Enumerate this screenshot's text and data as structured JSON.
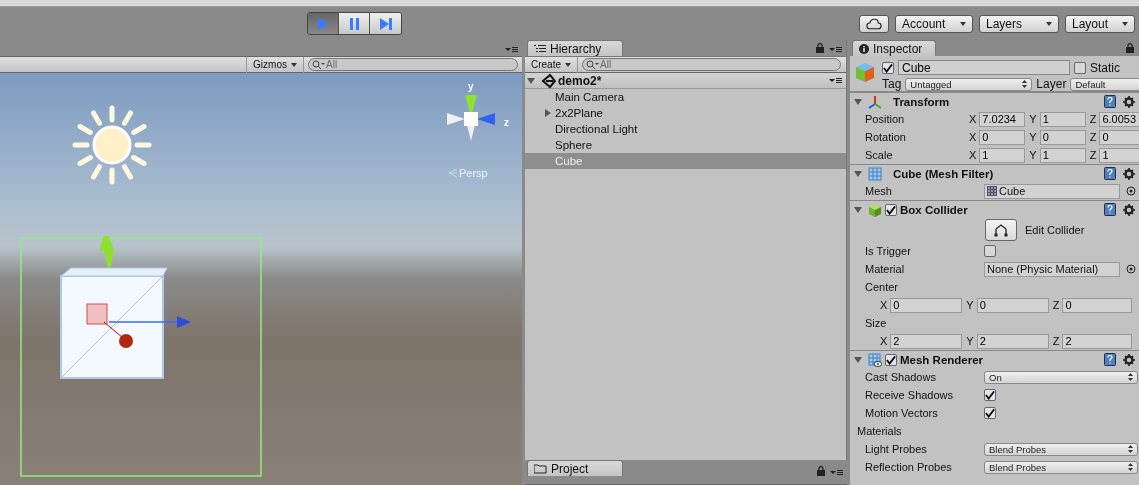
{
  "toolbar": {
    "play_controls": [
      {
        "kind": "play",
        "selected": true
      },
      {
        "kind": "pause",
        "selected": false
      },
      {
        "kind": "step",
        "selected": false
      }
    ],
    "account": "Account",
    "layers": "Layers",
    "layout": "Layout"
  },
  "scene": {
    "gizmos": "Gizmos",
    "search_placeholder": "All",
    "axis_y": "y",
    "axis_z": "z",
    "projection": "Persp"
  },
  "hierarchy": {
    "tab": "Hierarchy",
    "create": "Create",
    "search_placeholder": "All",
    "scene": "demo2*",
    "expanded": true,
    "items": [
      {
        "label": "Main Camera",
        "selected": false,
        "has_children": false
      },
      {
        "label": "2x2Plane",
        "selected": false,
        "has_children": true
      },
      {
        "label": "Directional Light",
        "selected": false,
        "has_children": false
      },
      {
        "label": "Sphere",
        "selected": false,
        "has_children": false
      },
      {
        "label": "Cube",
        "selected": true,
        "has_children": false
      }
    ]
  },
  "project": {
    "tab": "Project"
  },
  "inspector": {
    "tab": "Inspector",
    "active": true,
    "name": "Cube",
    "static_label": "Static",
    "static": false,
    "tag_label": "Tag",
    "tag": "Untagged",
    "layer_label": "Layer",
    "layer": "Default",
    "components": [
      {
        "kind": "transform",
        "title": "Transform",
        "expanded": true,
        "rows": [
          {
            "kind": "vector",
            "label": "Position",
            "fields": [
              {
                "axis": "X",
                "value": "7.0234"
              },
              {
                "axis": "Y",
                "value": "1"
              },
              {
                "axis": "Z",
                "value": "6.0053"
              }
            ]
          },
          {
            "kind": "vector",
            "label": "Rotation",
            "fields": [
              {
                "axis": "X",
                "value": "0"
              },
              {
                "axis": "Y",
                "value": "0"
              },
              {
                "axis": "Z",
                "value": "0"
              }
            ]
          },
          {
            "kind": "vector",
            "label": "Scale",
            "fields": [
              {
                "axis": "X",
                "value": "1"
              },
              {
                "axis": "Y",
                "value": "1"
              },
              {
                "axis": "Z",
                "value": "1"
              }
            ]
          }
        ]
      },
      {
        "kind": "mesh_filter",
        "title": "Cube (Mesh Filter)",
        "expanded": true,
        "rows": [
          {
            "kind": "object",
            "label": "Mesh",
            "value": "Cube"
          }
        ]
      },
      {
        "kind": "box_collider",
        "title": "Box Collider",
        "enabled": true,
        "expanded": true,
        "rows": [
          {
            "kind": "button",
            "label": "Edit Collider"
          },
          {
            "kind": "checkbox",
            "label": "Is Trigger",
            "checked": false
          },
          {
            "kind": "object",
            "label": "Material",
            "value": "None (Physic Material)"
          },
          {
            "kind": "heading",
            "label": "Center"
          },
          {
            "kind": "subvector",
            "fields": [
              {
                "axis": "X",
                "value": "0"
              },
              {
                "axis": "Y",
                "value": "0"
              },
              {
                "axis": "Z",
                "value": "0"
              }
            ]
          },
          {
            "kind": "heading",
            "label": "Size"
          },
          {
            "kind": "subvector",
            "fields": [
              {
                "axis": "X",
                "value": "2"
              },
              {
                "axis": "Y",
                "value": "2"
              },
              {
                "axis": "Z",
                "value": "2"
              }
            ]
          }
        ]
      },
      {
        "kind": "mesh_renderer",
        "title": "Mesh Renderer",
        "enabled": true,
        "expanded": true,
        "rows": [
          {
            "kind": "dropdown",
            "label": "Cast Shadows",
            "value": "On"
          },
          {
            "kind": "checkbox",
            "label": "Receive Shadows",
            "checked": true
          },
          {
            "kind": "checkbox",
            "label": "Motion Vectors",
            "checked": true
          },
          {
            "kind": "foldout",
            "label": "Materials"
          },
          {
            "kind": "dropdown",
            "label": "Light Probes",
            "value": "Blend Probes"
          },
          {
            "kind": "dropdown",
            "label": "Reflection Probes",
            "value": "Blend Probes"
          }
        ]
      }
    ]
  }
}
